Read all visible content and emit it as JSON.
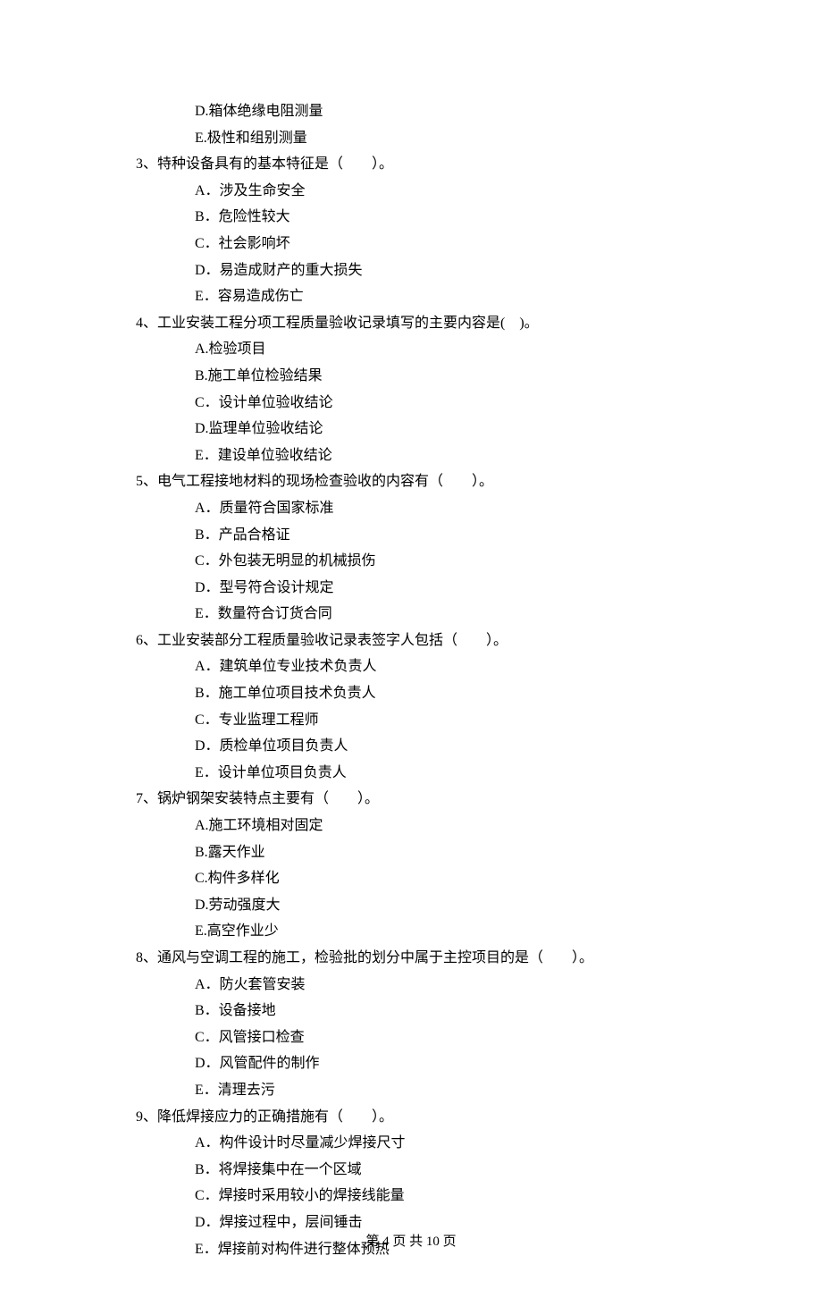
{
  "leftover_options": [
    "D.箱体绝缘电阻测量",
    "E.极性和组别测量"
  ],
  "questions": [
    {
      "num": "3、",
      "text": "特种设备具有的基本特征是（　　）。",
      "options": [
        "A．涉及生命安全",
        "B．危险性较大",
        "C．社会影响坏",
        "D．易造成财产的重大损失",
        "E．容易造成伤亡"
      ]
    },
    {
      "num": "4、",
      "text": "工业安装工程分项工程质量验收记录填写的主要内容是(　)。",
      "options": [
        "A.检验项目",
        "B.施工单位检验结果",
        "C．设计单位验收结论",
        "D.监理单位验收结论",
        "E．建设单位验收结论"
      ]
    },
    {
      "num": "5、",
      "text": "电气工程接地材料的现场检查验收的内容有（　　）。",
      "options": [
        "A．质量符合国家标准",
        "B．产品合格证",
        "C．外包装无明显的机械损伤",
        "D．型号符合设计规定",
        "E．数量符合订货合同"
      ]
    },
    {
      "num": "6、",
      "text": "工业安装部分工程质量验收记录表签字人包括（　　）。",
      "options": [
        "A．建筑单位专业技术负责人",
        "B．施工单位项目技术负责人",
        "C．专业监理工程师",
        "D．质检单位项目负责人",
        "E．设计单位项目负责人"
      ]
    },
    {
      "num": "7、",
      "text": "锅炉钢架安装特点主要有（　　）。",
      "options": [
        "A.施工环境相对固定",
        "B.露天作业",
        "C.构件多样化",
        "D.劳动强度大",
        "E.高空作业少"
      ]
    },
    {
      "num": "8、",
      "text": "通风与空调工程的施工，检验批的划分中属于主控项目的是（　　）。",
      "options": [
        "A．防火套管安装",
        "B．设备接地",
        "C．风管接口检查",
        "D．风管配件的制作",
        "E．清理去污"
      ]
    },
    {
      "num": "9、",
      "text": "降低焊接应力的正确措施有（　　）。",
      "options": [
        "A．构件设计时尽量减少焊接尺寸",
        "B．将焊接集中在一个区域",
        "C．焊接时采用较小的焊接线能量",
        "D．焊接过程中，层间锤击",
        "E．焊接前对构件进行整体预热"
      ]
    }
  ],
  "footer": "第 4 页 共 10 页"
}
